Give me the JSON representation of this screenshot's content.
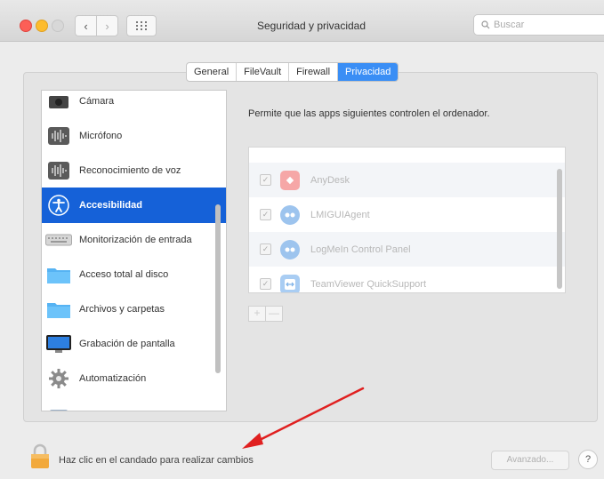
{
  "window": {
    "title": "Seguridad y privacidad"
  },
  "search": {
    "placeholder": "Buscar"
  },
  "tabs": [
    {
      "label": "General"
    },
    {
      "label": "FileVault"
    },
    {
      "label": "Firewall"
    },
    {
      "label": "Privacidad"
    }
  ],
  "sidebar": {
    "items": [
      {
        "label": "Cámara",
        "icon": "camera-icon"
      },
      {
        "label": "Micrófono",
        "icon": "microphone-icon"
      },
      {
        "label": "Reconocimiento de voz",
        "icon": "speech-icon"
      },
      {
        "label": "Accesibilidad",
        "icon": "accessibility-icon",
        "selected": true
      },
      {
        "label": "Monitorización de entrada",
        "icon": "keyboard-icon"
      },
      {
        "label": "Acceso total al disco",
        "icon": "folder-icon"
      },
      {
        "label": "Archivos y carpetas",
        "icon": "folder-icon"
      },
      {
        "label": "Grabación de pantalla",
        "icon": "display-icon"
      },
      {
        "label": "Automatización",
        "icon": "gear-icon"
      }
    ]
  },
  "main": {
    "description": "Permite que las apps siguientes controlen el ordenador.",
    "apps": [
      {
        "name": "AnyDesk",
        "checked": true,
        "icon": "anydesk-icon"
      },
      {
        "name": "LMIGUIAgent",
        "checked": true,
        "icon": "logmein-icon"
      },
      {
        "name": "LogMeIn Control Panel",
        "checked": true,
        "icon": "logmein-icon"
      },
      {
        "name": "TeamViewer QuickSupport",
        "checked": true,
        "icon": "teamviewer-icon"
      }
    ],
    "add_label": "+",
    "remove_label": "—"
  },
  "footer": {
    "lock_text": "Haz clic en el candado para realizar cambios",
    "advanced_label": "Avanzado...",
    "help_label": "?"
  },
  "colors": {
    "selection": "#1561d8",
    "tab_active": "#3a8ef5",
    "arrow": "#e02020"
  }
}
